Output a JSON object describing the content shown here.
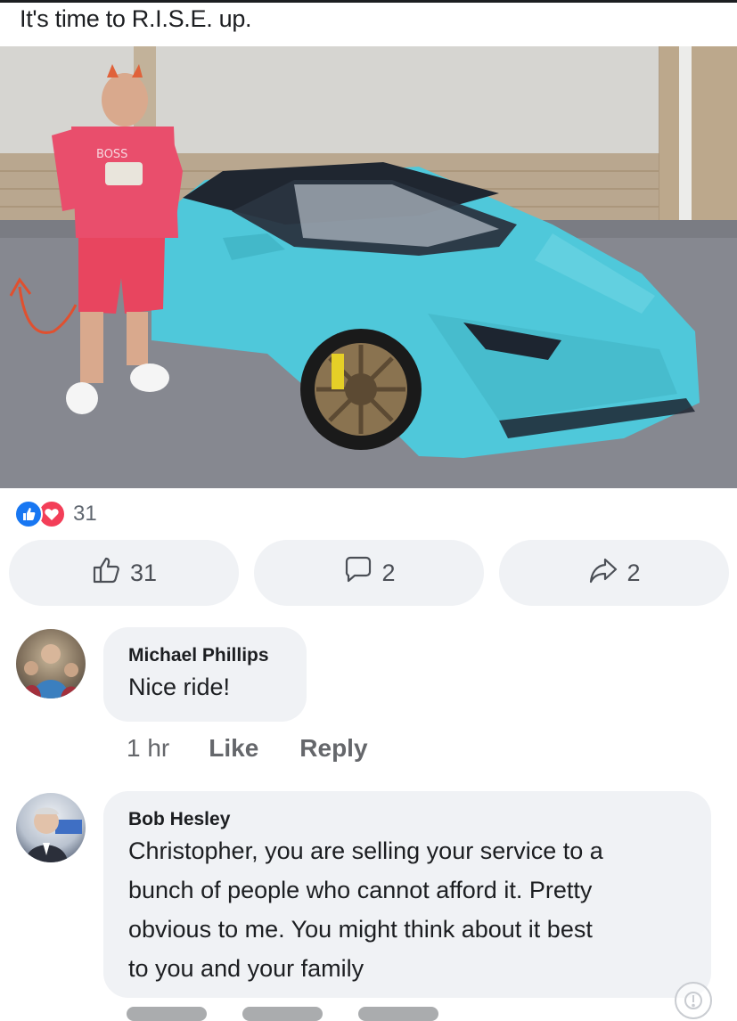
{
  "post": {
    "text": "It's time to R.I.S.E. up.",
    "photo_logo": "BOSS"
  },
  "reactions": {
    "count": "31",
    "icons": [
      "like-icon",
      "love-icon"
    ]
  },
  "actions": {
    "like_count": "31",
    "comment_count": "2",
    "share_count": "2"
  },
  "comments": [
    {
      "author": "Michael Phillips",
      "text": "Nice ride!",
      "time": "1 hr",
      "like_label": "Like",
      "reply_label": "Reply"
    },
    {
      "author": "Bob Hesley",
      "lines": [
        "Christopher, you are selling your service to a",
        "bunch of people who cannot afford it. Pretty",
        "obvious to me. You might think about it best",
        "to you and your family"
      ]
    }
  ],
  "colors": {
    "accent_blue": "#1877f2",
    "love_red": "#f33e58",
    "bubble_bg": "#f0f2f5",
    "meta_gray": "#65676b",
    "car_cyan": "#4fc8da"
  }
}
